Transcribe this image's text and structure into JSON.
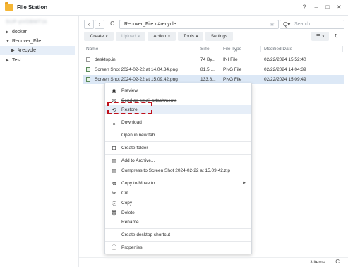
{
  "window": {
    "title": "File Station",
    "help": "?",
    "minimize": "–",
    "maximize": "□",
    "close": "✕"
  },
  "sidebar": {
    "host": "SUP-pVOBMT1k",
    "items": [
      {
        "label": "docker",
        "arrow": "▶"
      },
      {
        "label": "Recover_File",
        "arrow": "▼"
      },
      {
        "label": "#recycle",
        "arrow": "▶"
      },
      {
        "label": "Test",
        "arrow": "▶"
      }
    ]
  },
  "nav": {
    "back": "‹",
    "forward": "›",
    "refresh": "C"
  },
  "path": {
    "text": "Recover_File › #recycle",
    "star": "★"
  },
  "search": {
    "placeholder": "Search",
    "icon": "Q▾"
  },
  "toolbar": {
    "create": "Create",
    "upload": "Upload",
    "action": "Action",
    "tools": "Tools",
    "settings": "Settings",
    "caret": "▾",
    "view_icon": "☰",
    "view_caret": "▾",
    "sort_icon": "⇅"
  },
  "columns": {
    "name": "Name",
    "size": "Size",
    "type": "File Type",
    "modified": "Modified Date"
  },
  "files": [
    {
      "name": "desktop.ini",
      "size": "74 By...",
      "type": "INI File",
      "modified": "02/22/2024 15:52:40"
    },
    {
      "name": "Screen Shot 2024-02-22 at 14.04.34.png",
      "size": "81.5 ...",
      "type": "PNG File",
      "modified": "02/22/2024 14:04:39"
    },
    {
      "name": "Screen Shot 2024-02-22 at 15.09.42.png",
      "size": "133.8...",
      "type": "PNG File",
      "modified": "02/22/2024 15:09:49"
    }
  ],
  "context_menu": {
    "preview": {
      "label": "Preview",
      "icon": "◉"
    },
    "send_email": {
      "label": "Send as email attachments",
      "icon": "✉"
    },
    "restore": {
      "label": "Restore",
      "icon": "⟲"
    },
    "download": {
      "label": "Download",
      "icon": "⤓"
    },
    "open_tab": {
      "label": "Open in new tab"
    },
    "create_folder": {
      "label": "Create folder",
      "icon": "⊞"
    },
    "add_archive": {
      "label": "Add to Archive...",
      "icon": "▤"
    },
    "compress": {
      "label": "Compress to Screen Shot 2024-02-22 at 15.09.42.zip",
      "icon": "▤"
    },
    "copy_move": {
      "label": "Copy to/Move to ...",
      "icon": "⧉",
      "sub": "▶"
    },
    "cut": {
      "label": "Cut",
      "icon": "✂"
    },
    "copy": {
      "label": "Copy",
      "icon": "⎘"
    },
    "delete": {
      "label": "Delete",
      "icon": "🗑"
    },
    "rename": {
      "label": "Rename"
    },
    "shortcut": {
      "label": "Create desktop shortcut"
    },
    "properties": {
      "label": "Properties",
      "icon": "ⓘ"
    }
  },
  "status": {
    "count": "3 items",
    "refresh": "C"
  },
  "colors": {
    "accent": "#c0101a",
    "selection": "#dce8f6",
    "hover": "#e6eef8"
  }
}
